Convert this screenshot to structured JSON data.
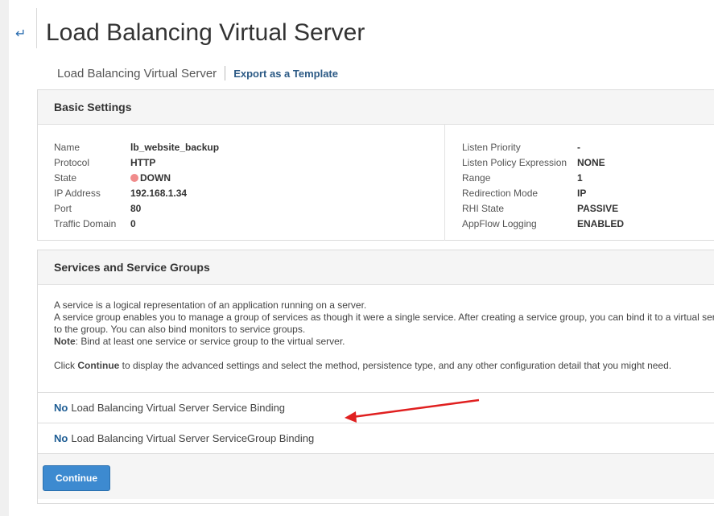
{
  "header": {
    "title": "Load Balancing Virtual Server",
    "back_icon": "back-arrow-icon"
  },
  "breadcrumb": {
    "current": "Load Balancing Virtual Server",
    "link": "Export as a Template"
  },
  "basic_settings": {
    "title": "Basic Settings",
    "left": [
      {
        "key": "Name",
        "value": "lb_website_backup"
      },
      {
        "key": "Protocol",
        "value": "HTTP"
      },
      {
        "key": "State",
        "value": "DOWN",
        "status_color": "#f08b8b"
      },
      {
        "key": "IP Address",
        "value": "192.168.1.34"
      },
      {
        "key": "Port",
        "value": "80"
      },
      {
        "key": "Traffic Domain",
        "value": "0"
      }
    ],
    "right": [
      {
        "key": "Listen Priority",
        "value": "-"
      },
      {
        "key": "Listen Policy Expression",
        "value": "NONE"
      },
      {
        "key": "Range",
        "value": "1"
      },
      {
        "key": "Redirection Mode",
        "value": "IP"
      },
      {
        "key": "RHI State",
        "value": "PASSIVE"
      },
      {
        "key": "AppFlow Logging",
        "value": "ENABLED"
      }
    ]
  },
  "services": {
    "title": "Services and Service Groups",
    "desc_line1": "A service is a logical representation of an application running on a server.",
    "desc_line2": "A service group enables you to manage a group of services as though it were a single service. After creating a service group, you can bind it to a virtual server and add services",
    "desc_line3": "to the group. You can also bind monitors to service groups.",
    "note_label": "Note",
    "note_text": ": Bind at least one service or service group to the virtual server.",
    "click_prefix": "Click ",
    "click_bold": "Continue",
    "click_suffix": " to display the advanced settings and select the method, persistence type, and any other configuration detail that you might need.",
    "bindings": [
      {
        "no": "No",
        "label": "Load Balancing Virtual Server Service Binding"
      },
      {
        "no": "No",
        "label": "Load Balancing Virtual Server ServiceGroup Binding"
      }
    ],
    "continue_label": "Continue"
  },
  "colors": {
    "accent": "#3d8ad0",
    "link": "#2c5a85",
    "annotation_arrow": "#e02020"
  }
}
